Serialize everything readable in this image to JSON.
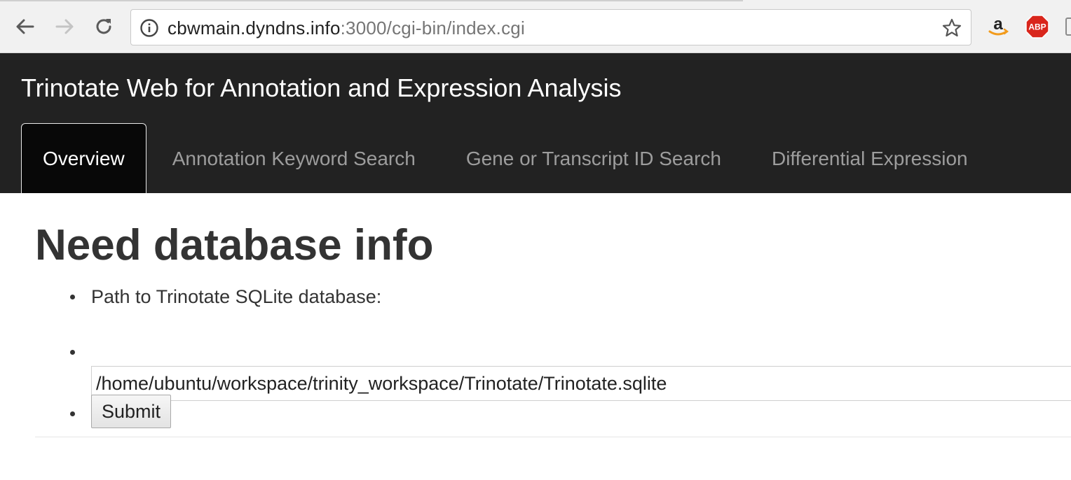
{
  "browser": {
    "url_host": "cbwmain.dyndns.info",
    "url_rest": ":3000/cgi-bin/index.cgi",
    "extensions": [
      {
        "name": "amazon-icon",
        "label": ""
      },
      {
        "name": "adblock-plus-icon",
        "label": "ABP"
      }
    ]
  },
  "navbar": {
    "brand": "Trinotate Web for Annotation and Expression Analysis",
    "tabs": [
      {
        "label": "Overview",
        "active": true
      },
      {
        "label": "Annotation Keyword Search",
        "active": false
      },
      {
        "label": "Gene or Transcript ID Search",
        "active": false
      },
      {
        "label": "Differential Expression",
        "active": false
      }
    ]
  },
  "main": {
    "title": "Need database info",
    "form": {
      "path_label": "Path to Trinotate SQLite database:",
      "path_value": "/home/ubuntu/workspace/trinity_workspace/Trinotate/Trinotate.sqlite",
      "submit_label": "Submit"
    }
  },
  "colors": {
    "navbar_bg": "#222222",
    "active_tab_bg": "#080808",
    "inactive_tab_text": "#9d9d9d",
    "abp_red": "#d9261c"
  }
}
